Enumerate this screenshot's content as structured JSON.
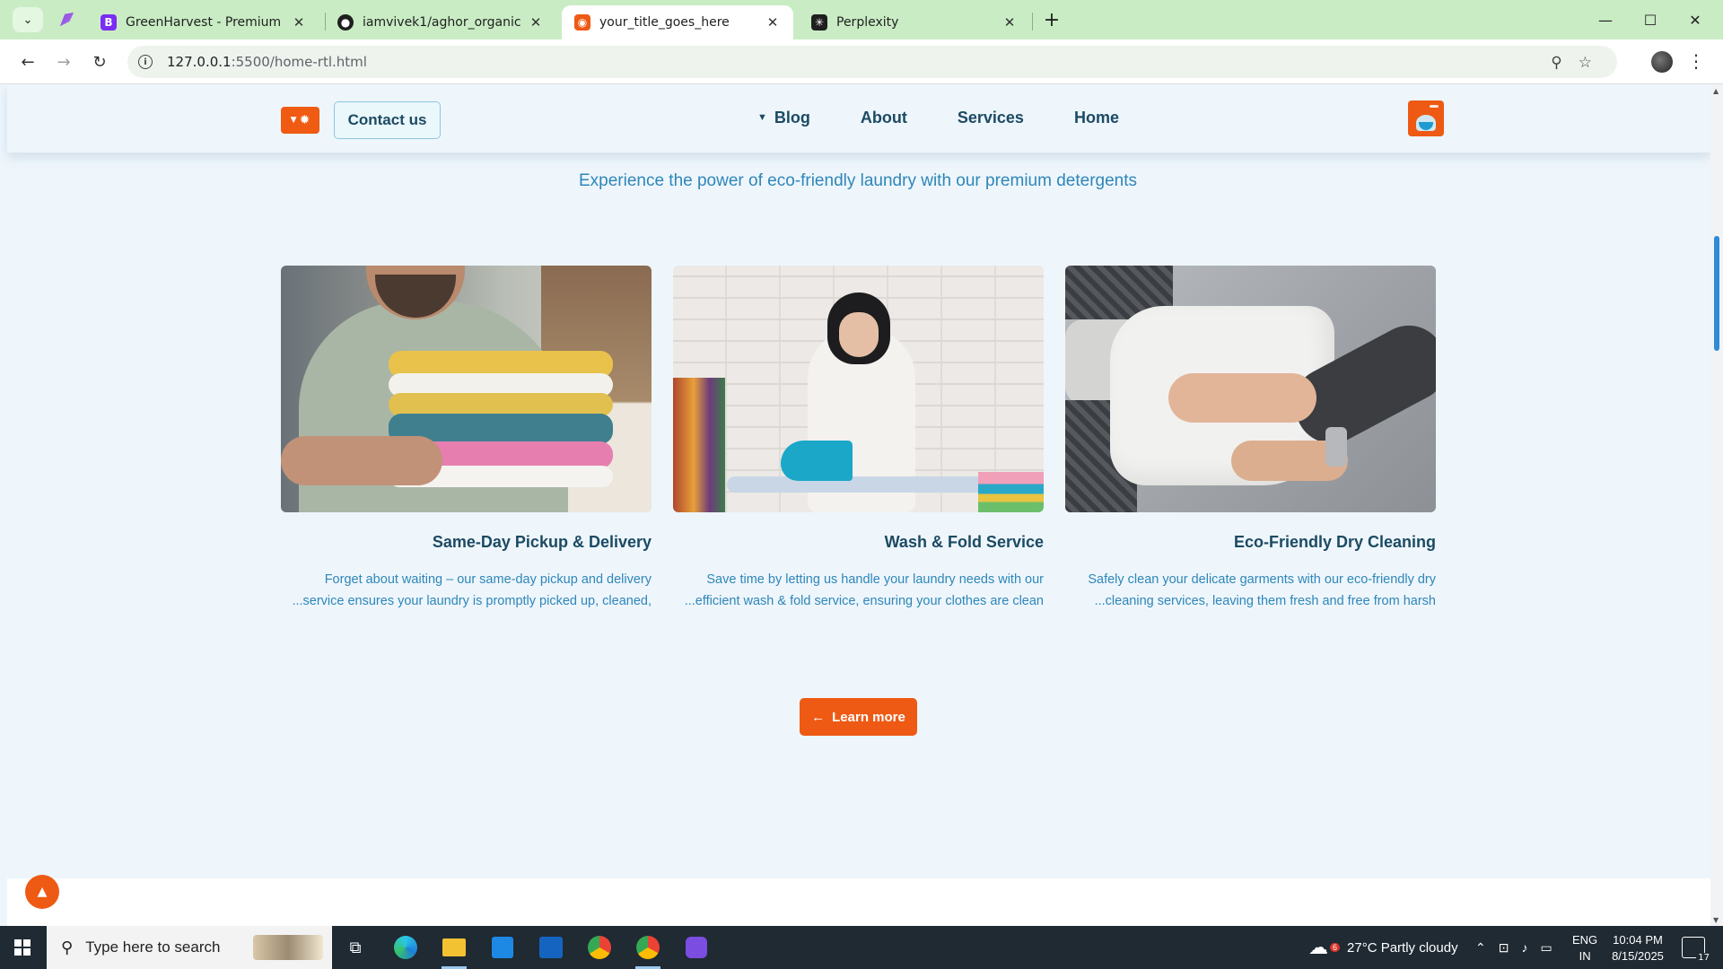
{
  "browser": {
    "tabs": [
      {
        "title": "GreenHarvest - Premium Organ",
        "favicon": "B",
        "favicon_color": "#7b2cf5",
        "active": false
      },
      {
        "title": "iamvivek1/aghor_organic",
        "favicon": "github",
        "favicon_color": "#1f1f1f",
        "active": false
      },
      {
        "title": "your_title_goes_here",
        "favicon": "laundry",
        "favicon_color": "#ee5a14",
        "active": true
      },
      {
        "title": "Perplexity",
        "favicon": "perplexity",
        "favicon_color": "#1f1f1f",
        "active": false
      }
    ],
    "url_host": "127.0.0.1",
    "url_rest": ":5500/home-rtl.html"
  },
  "header": {
    "contact_label": "Contact us",
    "nav": [
      {
        "label": "Blog",
        "has_dropdown": true
      },
      {
        "label": "About"
      },
      {
        "label": "Services"
      },
      {
        "label": "Home"
      }
    ]
  },
  "section": {
    "subtitle": "Experience the power of eco-friendly laundry with our premium detergents",
    "cards": [
      {
        "title": "Same-Day Pickup & Delivery",
        "line1": "Forget about waiting – our same-day pickup and delivery",
        "line2": "...service ensures your laundry is promptly picked up, cleaned,"
      },
      {
        "title": "Wash & Fold Service",
        "line1": "Save time by letting us handle your laundry needs with our",
        "line2": "...efficient wash & fold service, ensuring your clothes are clean"
      },
      {
        "title": "Eco-Friendly Dry Cleaning",
        "line1": "Safely clean your delicate garments with our eco-friendly dry",
        "line2": "...cleaning services, leaving them fresh and free from harsh"
      }
    ],
    "learn_more_label": "Learn more"
  },
  "colors": {
    "accent": "#ee5a14",
    "heading": "#1c4a63",
    "body_text": "#2e86b8",
    "page_bg": "#eef6fc"
  },
  "taskbar": {
    "search_placeholder": "Type here to search",
    "weather": "27°C  Partly cloudy",
    "weather_badge": "6",
    "lang_top": "ENG",
    "lang_bottom": "IN",
    "time": "10:04 PM",
    "date": "8/15/2025",
    "notification_count": "17"
  }
}
